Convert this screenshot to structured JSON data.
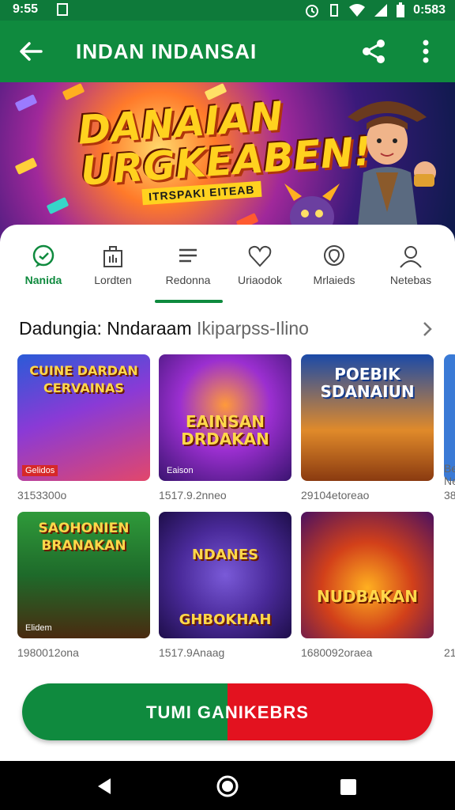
{
  "status_bar": {
    "time": "9:55",
    "clock_right": "0:583",
    "icons": [
      "sim-icon",
      "alarm-icon",
      "vibrate-icon",
      "wifi-icon",
      "signal-icon",
      "battery-icon"
    ]
  },
  "app_bar": {
    "title": "INDAN INDANSAI",
    "icons": [
      "back-arrow-icon",
      "share-icon",
      "more-vert-icon"
    ]
  },
  "banner": {
    "headline_line1": "DANAIAN",
    "headline_line2": "URGKEABEN!",
    "subline": "ITRSPAKI EITEAB"
  },
  "tabs": [
    {
      "label": "Nanida",
      "icon": "chat-icon",
      "active": false
    },
    {
      "label": "Lordten",
      "icon": "briefcase-icon",
      "active": false
    },
    {
      "label": "Redonna",
      "icon": "list-icon",
      "active": true
    },
    {
      "label": "Uriaodok",
      "icon": "heart-icon",
      "active": false
    },
    {
      "label": "Mrlaieds",
      "icon": "location-icon",
      "active": false
    },
    {
      "label": "Netebas",
      "icon": "person-icon",
      "active": false
    }
  ],
  "section": {
    "title": "Dadungia: Nndaraam",
    "title_muted": "Ikiparpss-Ilino"
  },
  "games": [
    {
      "title": "CUINE DARDAN CERVAINAS",
      "badge": "Gelidos",
      "meta": "3153300o"
    },
    {
      "title": "EAINSAN DRDAKAN",
      "badge": "Eaison",
      "meta": "1517.9.2nneo"
    },
    {
      "title": "POEBIK SDANAIUN",
      "badge": "",
      "meta": "29104etoreao"
    },
    {
      "title": "SAOHONIEN BRANAKAN",
      "badge": "Elidem",
      "meta": "1980012ona"
    },
    {
      "title": "NDANES GHBOKHAH",
      "badge": "",
      "meta": "1517.9Anaag"
    },
    {
      "title": "NUDBAKAN",
      "badge": "",
      "meta": "1680092oraea"
    }
  ],
  "partial_column": {
    "meta_top_1": "Be",
    "meta_top_2": "Ne",
    "meta_top_3": "38",
    "meta_bottom": "21"
  },
  "cta": {
    "label": "TUMI GANIKEBRS",
    "colors": {
      "left": "#0f8a3e",
      "right": "#e3121f"
    }
  },
  "colors": {
    "primary": "#0f8a3e",
    "status": "#0e7a3a"
  },
  "nav_icons": [
    "back-triangle-icon",
    "home-circle-icon",
    "recents-square-icon"
  ]
}
